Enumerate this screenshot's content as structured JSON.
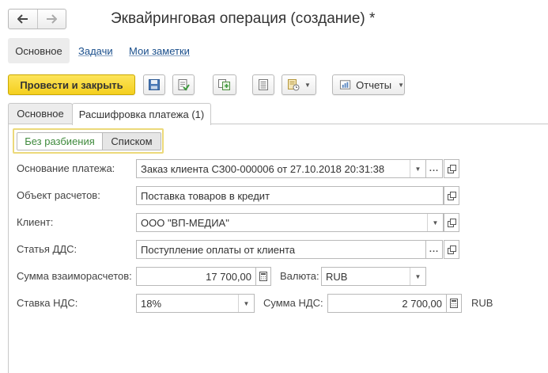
{
  "window": {
    "title": "Эквайринговая операция (создание) *"
  },
  "sections": {
    "main": "Основное",
    "tasks": "Задачи",
    "notes": "Мои заметки"
  },
  "toolbar": {
    "post_close": "Провести и закрыть",
    "reports": "Отчеты"
  },
  "tabs": {
    "main": "Основное",
    "decode": "Расшифровка платежа (1)"
  },
  "toggle": {
    "option_on": "Без разбиения",
    "option_off": "Списком"
  },
  "form": {
    "basis_label": "Основание платежа:",
    "basis_value": "Заказ клиента СЗ00-000006 от 27.10.2018 20:31:38",
    "object_label": "Объект расчетов:",
    "object_value": "Поставка товаров в кредит",
    "client_label": "Клиент:",
    "client_value": "ООО \"ВП-МЕДИА\"",
    "dds_label": "Статья ДДС:",
    "dds_value": "Поступление оплаты от клиента",
    "sum_label": "Сумма взаиморасчетов:",
    "sum_value": "17 700,00",
    "currency_label": "Валюта:",
    "currency_value": "RUB",
    "vat_rate_label": "Ставка НДС:",
    "vat_rate_value": "18%",
    "vat_sum_label": "Сумма НДС:",
    "vat_sum_value": "2 700,00",
    "vat_currency": "RUB"
  },
  "colors": {
    "primary_button": "#f4cf1e",
    "link": "#1a4f8c",
    "toggle_active_text": "#3f8a3c"
  }
}
